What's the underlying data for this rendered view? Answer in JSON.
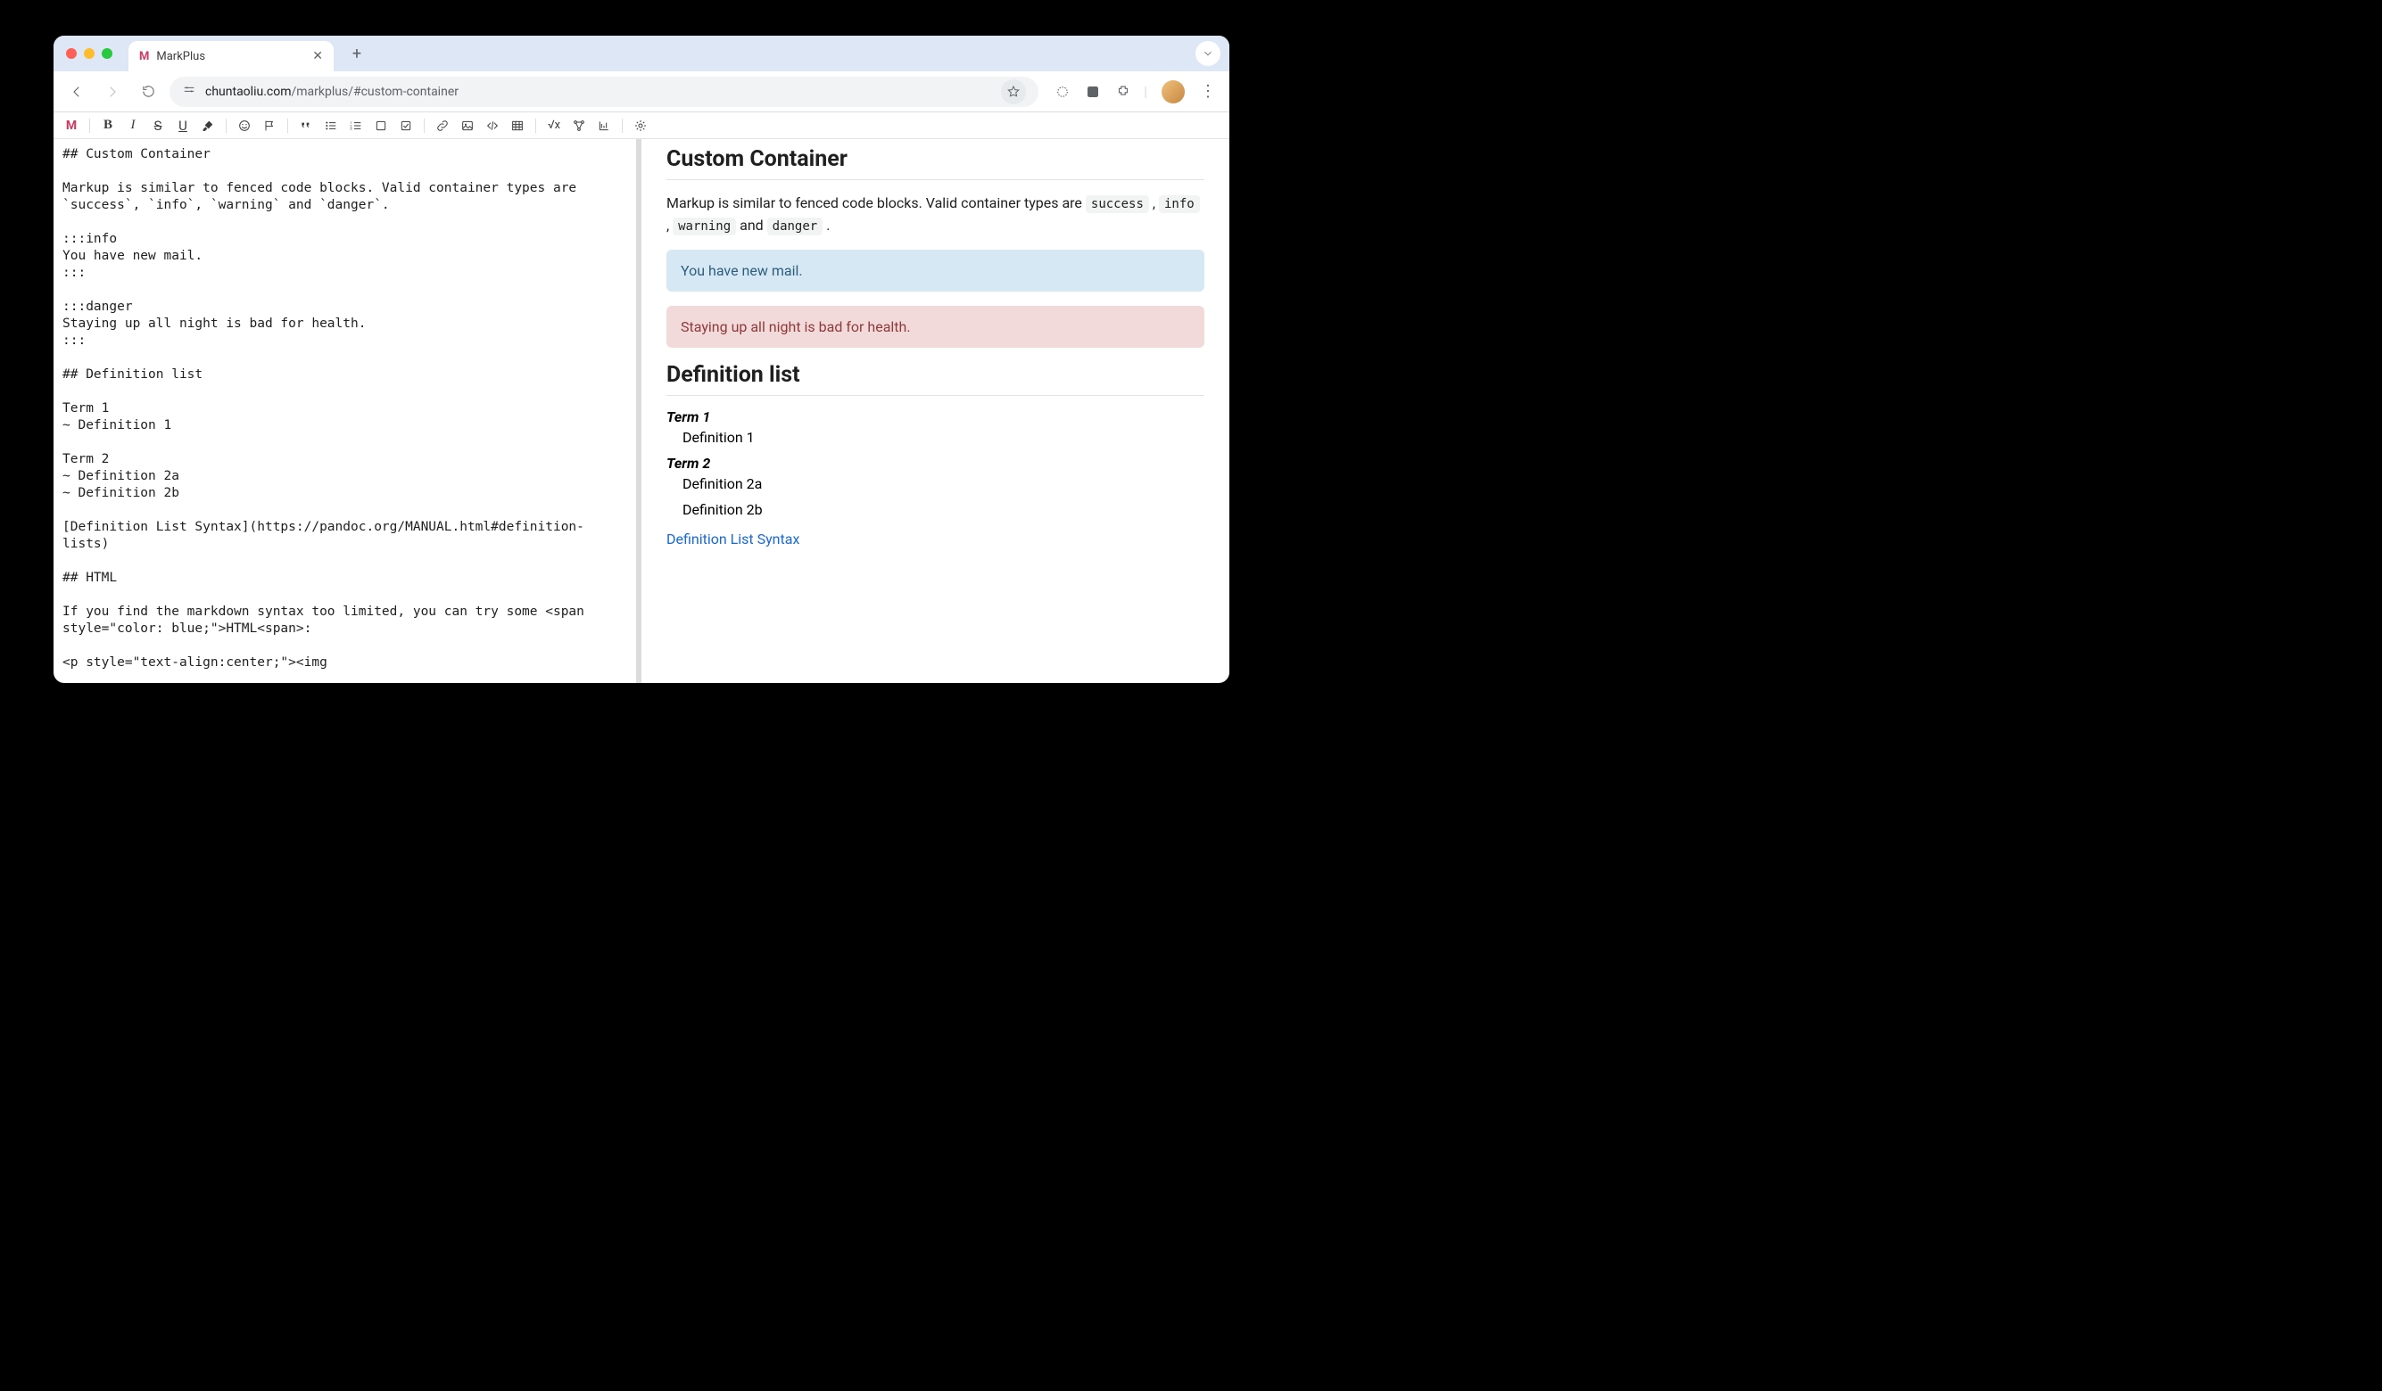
{
  "browser": {
    "tab_title": "MarkPlus",
    "url_domain": "chuntaoliu.com",
    "url_path": "/markplus/#custom-container"
  },
  "editor_source": "## Custom Container\n\nMarkup is similar to fenced code blocks. Valid container types are\n`success`, `info`, `warning` and `danger`.\n\n:::info\nYou have new mail.\n:::\n\n:::danger\nStaying up all night is bad for health.\n:::\n\n## Definition list\n\nTerm 1\n~ Definition 1\n\nTerm 2\n~ Definition 2a\n~ Definition 2b\n\n[Definition List Syntax](https://pandoc.org/MANUAL.html#definition-lists)\n\n## HTML\n\nIf you find the markdown syntax too limited, you can try some <span\nstyle=\"color: blue;\">HTML<span>:\n\n<p style=\"text-align:center;\"><img",
  "preview": {
    "heading1": "Custom Container",
    "intro_prefix": "Markup is similar to fenced code blocks. Valid container types are ",
    "code1": "success",
    "sep1": " , ",
    "code2": "info",
    "sep2": " , ",
    "code3": "warning",
    "mid": " and ",
    "code4": "danger",
    "end": " .",
    "info_text": "You have new mail.",
    "danger_text": "Staying up all night is bad for health.",
    "heading2": "Definition list",
    "term1": "Term 1",
    "def1": "Definition 1",
    "term2": "Term 2",
    "def2a": "Definition 2a",
    "def2b": "Definition 2b",
    "link_text": "Definition List Syntax"
  }
}
